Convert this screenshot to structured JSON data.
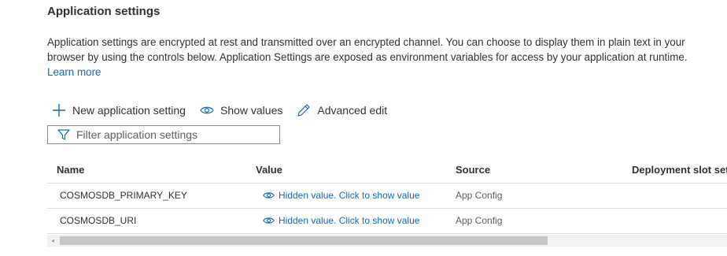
{
  "section": {
    "title": "Application settings",
    "description_line1": "Application settings are encrypted at rest and transmitted over an encrypted channel. You can choose to display them in plain text in your",
    "description_line2": "browser by using the controls below. Application Settings are exposed as environment variables for access by your application at runtime.",
    "learn_more": "Learn more"
  },
  "toolbar": {
    "new_setting": "New application setting",
    "show_values": "Show values",
    "advanced_edit": "Advanced edit",
    "accent_color": "#0f6cbd"
  },
  "filter": {
    "placeholder": "Filter application settings",
    "icon": "filter-icon"
  },
  "table": {
    "columns": [
      "Name",
      "Value",
      "Source",
      "Deployment slot set"
    ],
    "rows": [
      {
        "name": "COSMOSDB_PRIMARY_KEY",
        "value": "Hidden value. Click to show value",
        "source": "App Config"
      },
      {
        "name": "COSMOSDB_URI",
        "value": "Hidden value. Click to show value",
        "source": "App Config"
      }
    ]
  },
  "scrollbar": {
    "left_arrow": "◂"
  }
}
